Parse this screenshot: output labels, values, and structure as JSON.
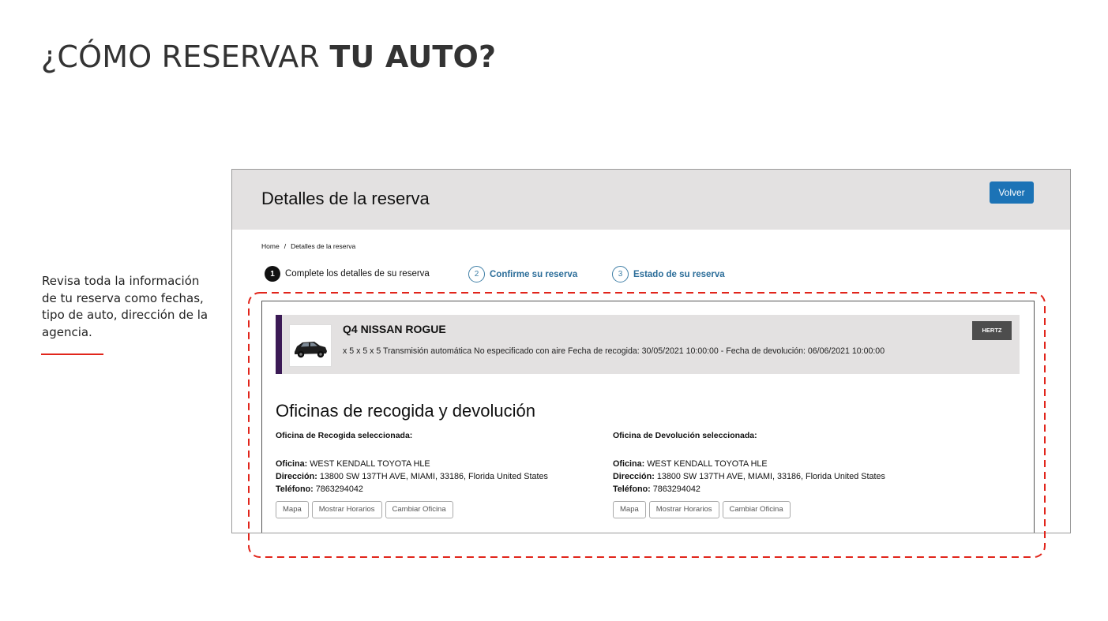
{
  "slide": {
    "title_light": "¿CÓMO RESERVAR ",
    "title_bold": "TU AUTO?",
    "note": "Revisa toda la información de tu reserva como fechas, tipo de auto, dirección de la agencia.",
    "accent_color": "#e1251b"
  },
  "panel": {
    "title": "Detalles de la reserva",
    "back_button": "Volver",
    "breadcrumb": {
      "home": "Home",
      "separator": "/",
      "current": "Detalles de la reserva"
    },
    "steps": [
      {
        "num": "1",
        "label": "Complete los detalles de su reserva",
        "state": "active"
      },
      {
        "num": "2",
        "label": "Confirme su reserva",
        "state": "pending"
      },
      {
        "num": "3",
        "label": "Estado de su reserva",
        "state": "pending"
      }
    ],
    "car": {
      "name": "Q4 NISSAN ROGUE",
      "description": "x 5 x 5 x 5 Transmisión automática No especificado con aire Fecha de recogida: 30/05/2021 10:00:00 - Fecha de devolución: 06/06/2021 10:00:00",
      "provider": "HERTZ",
      "image_icon": "suv-car-icon"
    },
    "offices_title": "Oficinas de recogida y devolución",
    "pickup": {
      "heading": "Oficina de Recogida seleccionada:",
      "office_label": "Oficina:",
      "office_value": "WEST KENDALL TOYOTA HLE",
      "address_label": "Dirección:",
      "address_value": "13800 SW 137TH AVE, MIAMI, 33186, Florida United States",
      "phone_label": "Teléfono:",
      "phone_value": "7863294042",
      "buttons": [
        "Mapa",
        "Mostrar Horarios",
        "Cambiar Oficina"
      ]
    },
    "return": {
      "heading": "Oficina de Devolución seleccionada:",
      "office_label": "Oficina:",
      "office_value": "WEST KENDALL TOYOTA HLE",
      "address_label": "Dirección:",
      "address_value": "13800 SW 137TH AVE, MIAMI, 33186, Florida United States",
      "phone_label": "Teléfono:",
      "phone_value": "7863294042",
      "buttons": [
        "Mapa",
        "Mostrar Horarios",
        "Cambiar Oficina"
      ]
    }
  }
}
